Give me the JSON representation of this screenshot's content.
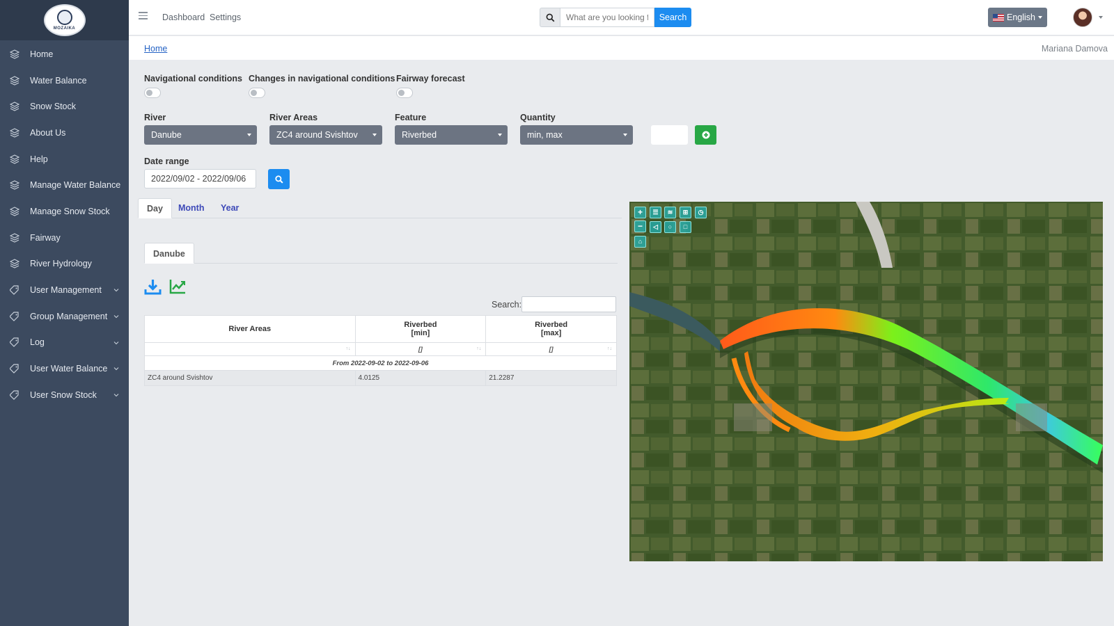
{
  "sidebar": {
    "logo_text": "MOZAIKA",
    "items": [
      {
        "label": "Home",
        "icon": "layers-icon",
        "expandable": false
      },
      {
        "label": "Water Balance",
        "icon": "layers-icon",
        "expandable": false
      },
      {
        "label": "Snow Stock",
        "icon": "layers-icon",
        "expandable": false
      },
      {
        "label": "About Us",
        "icon": "layers-icon",
        "expandable": false
      },
      {
        "label": "Help",
        "icon": "layers-icon",
        "expandable": false
      },
      {
        "label": "Manage Water Balance",
        "icon": "layers-icon",
        "expandable": false
      },
      {
        "label": "Manage Snow Stock",
        "icon": "layers-icon",
        "expandable": false
      },
      {
        "label": "Fairway",
        "icon": "layers-icon",
        "expandable": false
      },
      {
        "label": "River Hydrology",
        "icon": "layers-icon",
        "expandable": false
      },
      {
        "label": "User Management",
        "icon": "tag-icon",
        "expandable": true
      },
      {
        "label": "Group Management",
        "icon": "tag-icon",
        "expandable": true
      },
      {
        "label": "Log",
        "icon": "tag-icon",
        "expandable": true
      },
      {
        "label": "User Water Balance",
        "icon": "tag-icon",
        "expandable": true
      },
      {
        "label": "User Snow Stock",
        "icon": "tag-icon",
        "expandable": true
      }
    ]
  },
  "topbar": {
    "links": [
      "Dashboard",
      "Settings"
    ],
    "search_placeholder": "What are you looking for?",
    "search_button": "Search",
    "language": "English"
  },
  "breadcrumb": {
    "home": "Home",
    "user_name": "Mariana Damova"
  },
  "toggles": [
    {
      "label": "Navigational conditions",
      "on": false
    },
    {
      "label": "Changes in navigational conditions",
      "on": false
    },
    {
      "label": "Fairway forecast",
      "on": false
    }
  ],
  "filters": {
    "river": {
      "label": "River",
      "value": "Danube"
    },
    "areas": {
      "label": "River Areas",
      "value": "ZC4 around Svishtov"
    },
    "feature": {
      "label": "Feature",
      "value": "Riverbed"
    },
    "quantity": {
      "label": "Quantity",
      "value": "min, max"
    }
  },
  "date_range": {
    "label": "Date range",
    "value": "2022/09/02 - 2022/09/06"
  },
  "period_tabs": {
    "day": "Day",
    "month": "Month",
    "year": "Year",
    "active": "Day"
  },
  "river_tab": "Danube",
  "table": {
    "search_label": "Search:",
    "headers": {
      "areas": "River Areas",
      "min_top": "Riverbed",
      "min_bottom": "[min]",
      "max_top": "Riverbed",
      "max_bottom": "[max]"
    },
    "filter_marks": {
      "min": "[]",
      "max": "[]"
    },
    "group_label": "From 2022-09-02 to 2022-09-06",
    "rows": [
      {
        "area": "ZC4 around Svishtov",
        "min": "4.0125",
        "max": "21.2287"
      }
    ]
  },
  "colors": {
    "sidebar": "#3c4a5f",
    "primary": "#1c8cf0",
    "success": "#28a745",
    "tab_link": "#3d49b8"
  }
}
